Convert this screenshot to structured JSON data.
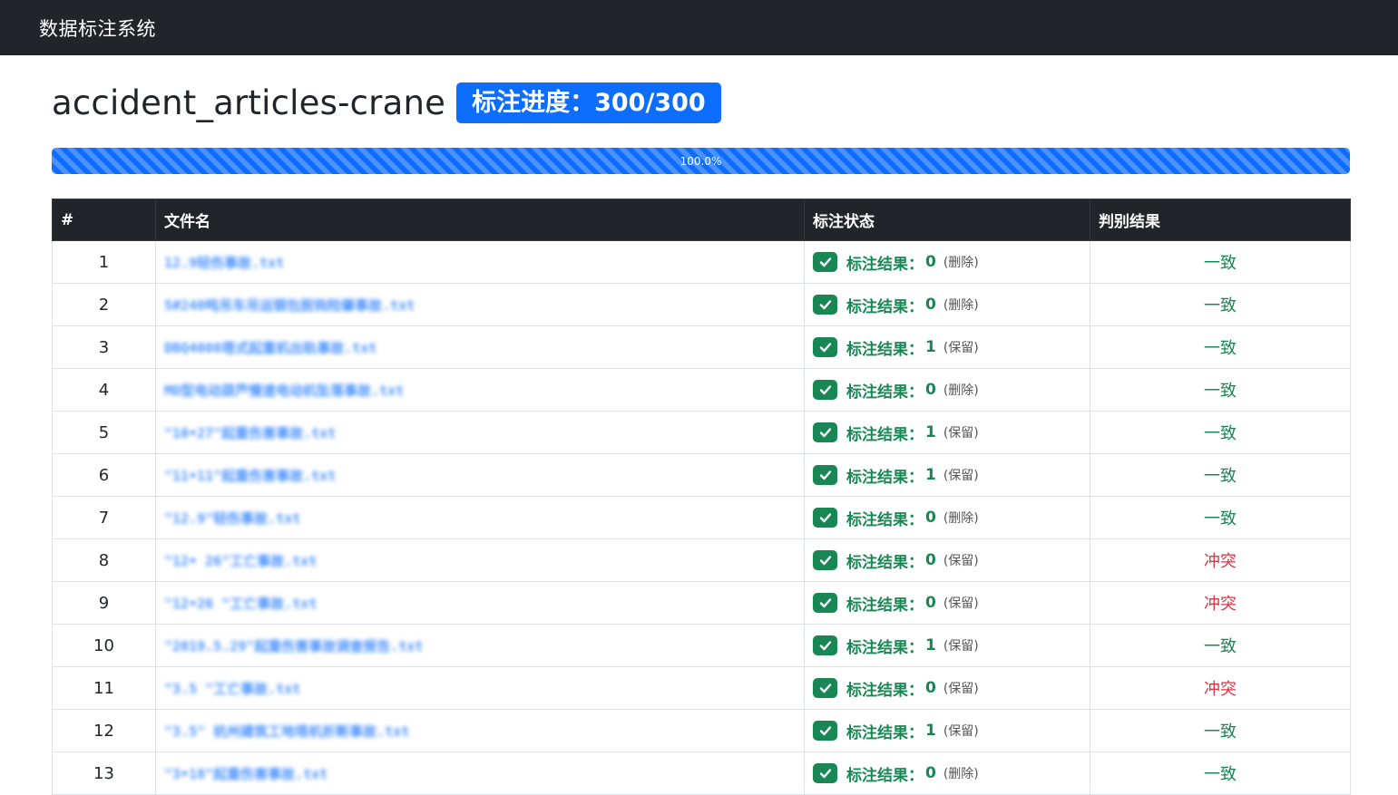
{
  "navbar": {
    "brand": "数据标注系统"
  },
  "page": {
    "dataset_title": "accident_articles-crane",
    "progress_badge": "标注进度：300/300",
    "progress_percent": 100.0,
    "progress_label": "100.0%"
  },
  "table": {
    "headers": [
      "#",
      "文件名",
      "标注状态",
      "判别结果"
    ],
    "status_prefix": "标注结果：",
    "colors": {
      "ok": "#198754",
      "conflict": "#dc3545",
      "accent": "#0d6efd"
    },
    "rows": [
      {
        "index": "1",
        "filename": "12.9轻伤事故.txt",
        "value": "0",
        "action": "(删除)",
        "result": "一致",
        "result_type": "ok"
      },
      {
        "index": "2",
        "filename": "5#240吨吊车吊运钢包脱钩险肇事故.txt",
        "value": "0",
        "action": "(删除)",
        "result": "一致",
        "result_type": "ok"
      },
      {
        "index": "3",
        "filename": "DBQ4000塔式起重机出轨事故.txt",
        "value": "1",
        "action": "(保留)",
        "result": "一致",
        "result_type": "ok"
      },
      {
        "index": "4",
        "filename": "MD型电动葫芦慢速电动机坠落事故.txt",
        "value": "0",
        "action": "(删除)",
        "result": "一致",
        "result_type": "ok"
      },
      {
        "index": "5",
        "filename": "\"10•27\"起重伤害事故.txt",
        "value": "1",
        "action": "(保留)",
        "result": "一致",
        "result_type": "ok"
      },
      {
        "index": "6",
        "filename": "\"11•11\"起重伤害事故.txt",
        "value": "1",
        "action": "(保留)",
        "result": "一致",
        "result_type": "ok"
      },
      {
        "index": "7",
        "filename": "\"12.9\"轻伤事故.txt",
        "value": "0",
        "action": "(删除)",
        "result": "一致",
        "result_type": "ok"
      },
      {
        "index": "8",
        "filename": "\"12• 26\"工亡事故.txt",
        "value": "0",
        "action": "(保留)",
        "result": "冲突",
        "result_type": "conflict"
      },
      {
        "index": "9",
        "filename": "\"12•26 \"工亡事故.txt",
        "value": "0",
        "action": "(保留)",
        "result": "冲突",
        "result_type": "conflict"
      },
      {
        "index": "10",
        "filename": "\"2019.5.29\"起重伤害事故调查报告.txt",
        "value": "1",
        "action": "(保留)",
        "result": "一致",
        "result_type": "ok"
      },
      {
        "index": "11",
        "filename": "\"3.5 \"工亡事故.txt",
        "value": "0",
        "action": "(保留)",
        "result": "冲突",
        "result_type": "conflict"
      },
      {
        "index": "12",
        "filename": "\"3.5\" 杭州建筑工地塔机折断事故.txt",
        "value": "1",
        "action": "(保留)",
        "result": "一致",
        "result_type": "ok"
      },
      {
        "index": "13",
        "filename": "\"3•18\"起重伤害事故.txt",
        "value": "0",
        "action": "(删除)",
        "result": "一致",
        "result_type": "ok"
      }
    ]
  }
}
